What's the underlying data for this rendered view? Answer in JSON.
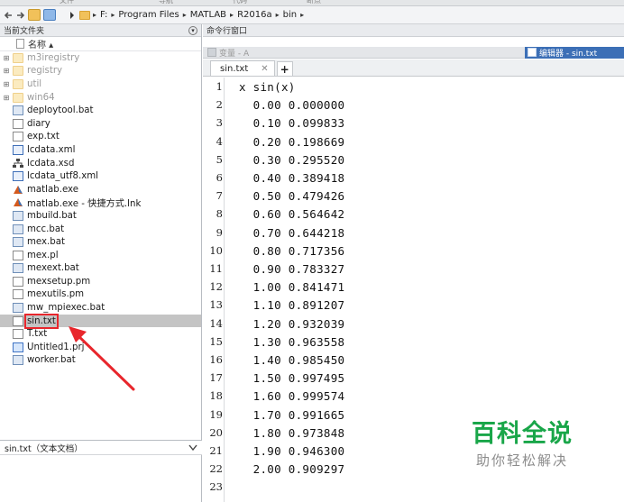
{
  "ribbon": {
    "labels": [
      "文件",
      "导航",
      "代码",
      "断点"
    ]
  },
  "address": {
    "crumbs": [
      "F:",
      "Program Files",
      "MATLAB",
      "R2016a",
      "bin"
    ]
  },
  "file_browser": {
    "title": "当前文件夹",
    "column_header": "名称 ▴",
    "items": [
      {
        "name": "m3iregistry",
        "type": "folder",
        "dim": true
      },
      {
        "name": "registry",
        "type": "folder",
        "dim": true
      },
      {
        "name": "util",
        "type": "folder",
        "dim": true
      },
      {
        "name": "win64",
        "type": "folder",
        "dim": true
      },
      {
        "name": "deploytool.bat",
        "type": "bat"
      },
      {
        "name": "diary",
        "type": "doc"
      },
      {
        "name": "exp.txt",
        "type": "doc"
      },
      {
        "name": "lcdata.xml",
        "type": "xml"
      },
      {
        "name": "lcdata.xsd",
        "type": "xsd"
      },
      {
        "name": "lcdata_utf8.xml",
        "type": "xml"
      },
      {
        "name": "matlab.exe",
        "type": "exe"
      },
      {
        "name": "matlab.exe - 快捷方式.lnk",
        "type": "exe"
      },
      {
        "name": "mbuild.bat",
        "type": "bat"
      },
      {
        "name": "mcc.bat",
        "type": "bat"
      },
      {
        "name": "mex.bat",
        "type": "bat"
      },
      {
        "name": "mex.pl",
        "type": "doc"
      },
      {
        "name": "mexext.bat",
        "type": "bat"
      },
      {
        "name": "mexsetup.pm",
        "type": "doc"
      },
      {
        "name": "mexutils.pm",
        "type": "doc"
      },
      {
        "name": "mw_mpiexec.bat",
        "type": "bat"
      },
      {
        "name": "sin.txt",
        "type": "doc",
        "selected": true
      },
      {
        "name": "T.txt",
        "type": "doc"
      },
      {
        "name": "Untitled1.prj",
        "type": "prj"
      },
      {
        "name": "worker.bat",
        "type": "bat"
      }
    ],
    "detail_label": "sin.txt（文本文档）"
  },
  "command_window": {
    "title": "命令行窗口"
  },
  "variables_bar": {
    "label": "变量 - A"
  },
  "editor_bar": {
    "label": "编辑器 - sin.txt"
  },
  "editor": {
    "tab_label": "sin.txt",
    "lines": [
      "x sin(x)",
      "  0.00 0.000000",
      "  0.10 0.099833",
      "  0.20 0.198669",
      "  0.30 0.295520",
      "  0.40 0.389418",
      "  0.50 0.479426",
      "  0.60 0.564642",
      "  0.70 0.644218",
      "  0.80 0.717356",
      "  0.90 0.783327",
      "  1.00 0.841471",
      "  1.10 0.891207",
      "  1.20 0.932039",
      "  1.30 0.963558",
      "  1.40 0.985450",
      "  1.50 0.997495",
      "  1.60 0.999574",
      "  1.70 0.991665",
      "  1.80 0.973848",
      "  1.90 0.946300",
      "  2.00 0.909297",
      ""
    ]
  },
  "watermark": {
    "title": "百科全说",
    "subtitle": "助你轻松解决"
  }
}
